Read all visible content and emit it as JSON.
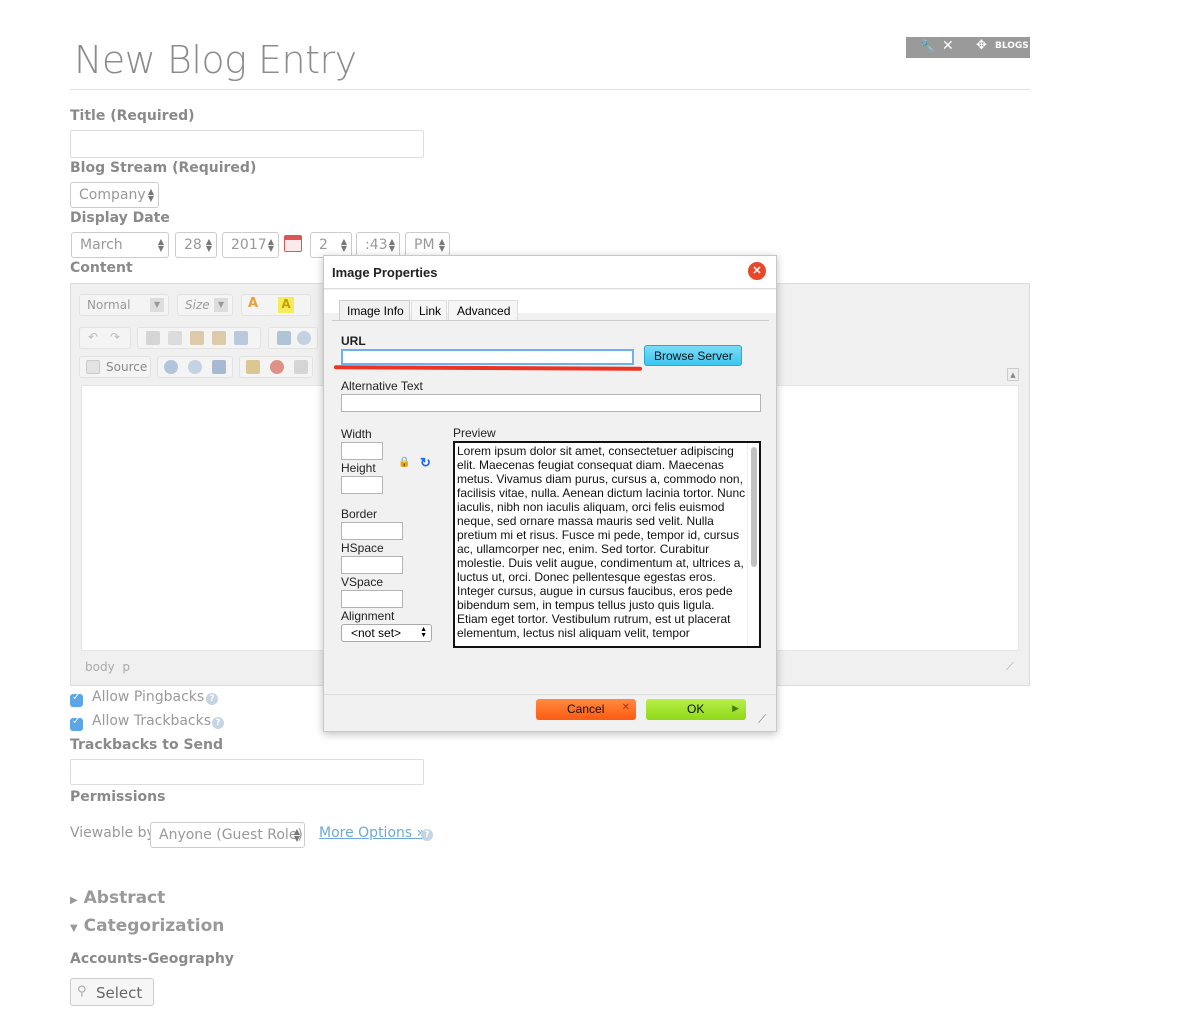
{
  "page": {
    "title": "New Blog Entry",
    "blogs_label": "BLOGS"
  },
  "form": {
    "title_label": "Title (Required)",
    "blog_stream_label": "Blog Stream (Required)",
    "blog_stream_value": "Company",
    "display_date_label": "Display Date",
    "date": {
      "month": "March",
      "day": "28",
      "year": "2017",
      "hour": "2",
      "minute": ":43",
      "ampm": "PM"
    },
    "content_label": "Content",
    "editor": {
      "format_value": "Normal",
      "size_value": "Size",
      "source_label": "Source",
      "status_path": [
        "body",
        "p"
      ]
    },
    "allow_pingbacks": "Allow Pingbacks",
    "allow_trackbacks": "Allow Trackbacks",
    "trackbacks_label": "Trackbacks to Send",
    "permissions_label": "Permissions",
    "viewable_by_label": "Viewable by",
    "viewable_by_value": "Anyone (Guest Role)",
    "more_options": "More Options »",
    "abstract_label": "Abstract",
    "categorization_label": "Categorization",
    "accounts_geography_label": "Accounts-Geography",
    "select_button": "Select"
  },
  "dialog": {
    "title": "Image Properties",
    "tabs": [
      "Image Info",
      "Link",
      "Advanced"
    ],
    "url_label": "URL",
    "url_value": "",
    "browse_server": "Browse Server",
    "alt_text_label": "Alternative Text",
    "width_label": "Width",
    "height_label": "Height",
    "border_label": "Border",
    "hspace_label": "HSpace",
    "vspace_label": "VSpace",
    "alignment_label": "Alignment",
    "alignment_value": "<not set>",
    "preview_label": "Preview",
    "preview_text": "Lorem ipsum dolor sit amet, consectetuer adipiscing elit. Maecenas feugiat consequat diam. Maecenas metus. Vivamus diam purus, cursus a, commodo non, facilisis vitae, nulla. Aenean dictum lacinia tortor. Nunc iaculis, nibh non iaculis aliquam, orci felis euismod neque, sed ornare massa mauris sed velit. Nulla pretium mi et risus. Fusce mi pede, tempor id, cursus ac, ullamcorper nec, enim. Sed tortor. Curabitur molestie. Duis velit augue, condimentum at, ultrices a, luctus ut, orci. Donec pellentesque egestas eros. Integer cursus, augue in cursus faucibus, eros pede bibendum sem, in tempus tellus justo quis ligula. Etiam eget tortor. Vestibulum rutrum, est ut placerat elementum, lectus nisl aliquam velit, tempor",
    "cancel": "Cancel",
    "ok": "OK"
  },
  "colors": {
    "annotation_red": "#ee3322",
    "cancel_orange": "#ff6a1a",
    "ok_green": "#9ee22a",
    "browse_cyan": "#3cc6ef",
    "link_blue": "#6aaad8"
  }
}
